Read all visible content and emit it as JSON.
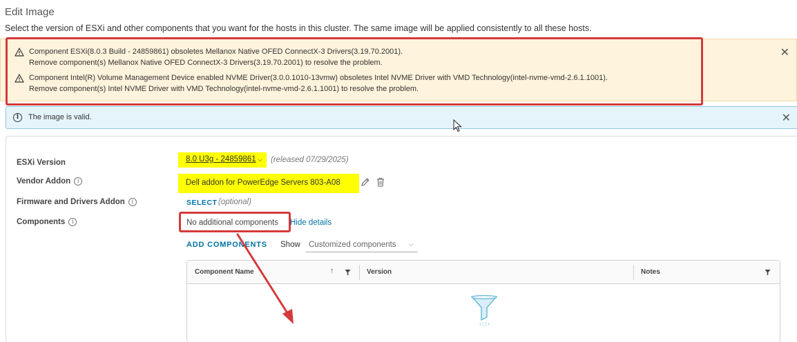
{
  "header": {
    "title": "Edit Image",
    "description": "Select the version of ESXi and other components that you want for the hosts in this cluster. The same image will be applied consistently to all these hosts."
  },
  "warnings": [
    {
      "line1": "Component ESXi(8.0.3 Build - 24859861) obsoletes Mellanox Native OFED ConnectX-3 Drivers(3.19.70.2001).",
      "line2": "Remove component(s) Mellanox Native OFED ConnectX-3 Drivers(3.19.70.2001) to resolve the problem."
    },
    {
      "line1": "Component Intel(R) Volume Management Device enabled NVME Driver(3.0.0.1010-13vmw) obsoletes Intel NVME Driver with VMD Technology(intel-nvme-vmd-2.6.1.1001).",
      "line2": "Remove component(s) Intel NVME Driver with VMD Technology(intel-nvme-vmd-2.6.1.1001) to resolve the problem."
    }
  ],
  "info": {
    "text": "The image is valid."
  },
  "form": {
    "esxi_version": {
      "label": "ESXi Version",
      "value": "8.0 U3g - 24859861",
      "released": "(released 07/29/2025)"
    },
    "vendor_addon": {
      "label": "Vendor Addon",
      "value": "Dell addon for PowerEdge Servers 803-A08"
    },
    "firmware": {
      "label": "Firmware and Drivers Addon",
      "select_label": "SELECT",
      "optional": "(optional)"
    },
    "components": {
      "label": "Components",
      "value": "No additional components",
      "hide_details": "Hide details"
    }
  },
  "components_toolbar": {
    "add_label": "ADD COMPONENTS",
    "show_label": "Show",
    "show_value": "Customized components"
  },
  "table": {
    "columns": [
      "Component Name",
      "Version",
      "Notes"
    ],
    "rows": []
  },
  "colors": {
    "warning_bg": "#fef3dc",
    "info_bg": "#e5f4fb",
    "link": "#0072a3",
    "annotation_red": "#d6393a",
    "highlight": "#ffff00"
  },
  "icons": [
    "warning-icon",
    "close-icon",
    "info-icon",
    "pencil-icon",
    "trash-icon",
    "chevron-down-icon",
    "sort-up-icon",
    "filter-icon",
    "empty-funnel-icon",
    "mouse-cursor-icon"
  ]
}
